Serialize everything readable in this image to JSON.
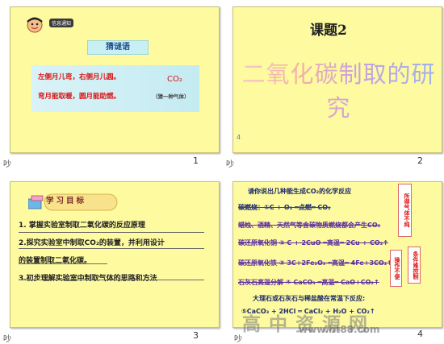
{
  "slides": [
    {
      "number": "1",
      "logo_text": "信息通知",
      "title": "猜谜语",
      "riddle_line1": "左侧月儿弯，右侧月儿圆。",
      "riddle_answer": "CO₂",
      "riddle_line2": "弯月能取暖，圆月能助燃。",
      "riddle_hint": "（猜一种气体）"
    },
    {
      "number": "2",
      "topic": "课题2",
      "title": "二氧化碳制取的研究",
      "mark": "4"
    },
    {
      "number": "3",
      "goal_label": "学习目标",
      "goals": [
        "1. 掌握实验室制取二氧化碳的反应原理",
        "2.探究实验室中制取CO₂的装置，并利用设计",
        "的装置制取二氧化碳。",
        "3.初步理解实验室中制取气体的思路和方法"
      ]
    },
    {
      "number": "4",
      "lines": [
        "请你说出几种能生成CO₂的化学反应",
        "碳燃烧：①C + O₂ ═点燃═ CO₂",
        "蜡烛、酒精、天然气等含碳物质燃烧都会产生CO₂",
        "碳还原氧化铜 ② C + 2CuO ═高温═ 2Cu + CO₂↑",
        "碳还原氧化铁 ③ 3C+2Fe₂O₃ ═高温═ 4Fe+3CO₂↑",
        "石灰石高温分解 ④ CaCO₃ ═高温═ CaO+CO₂↑",
        "大理石或石灰石与稀盐酸在常温下反应:",
        "⑤CaCO₃ + 2HCl ═ CaCl₂ + H₂O + CO₂↑"
      ],
      "side_note1": "所得气体不纯",
      "side_note2": "操作不便",
      "side_note3": "条件难控制"
    }
  ],
  "note_mark": "吵",
  "watermark": "高 中 资 源 网",
  "watermark_url": "www.ht88.com"
}
